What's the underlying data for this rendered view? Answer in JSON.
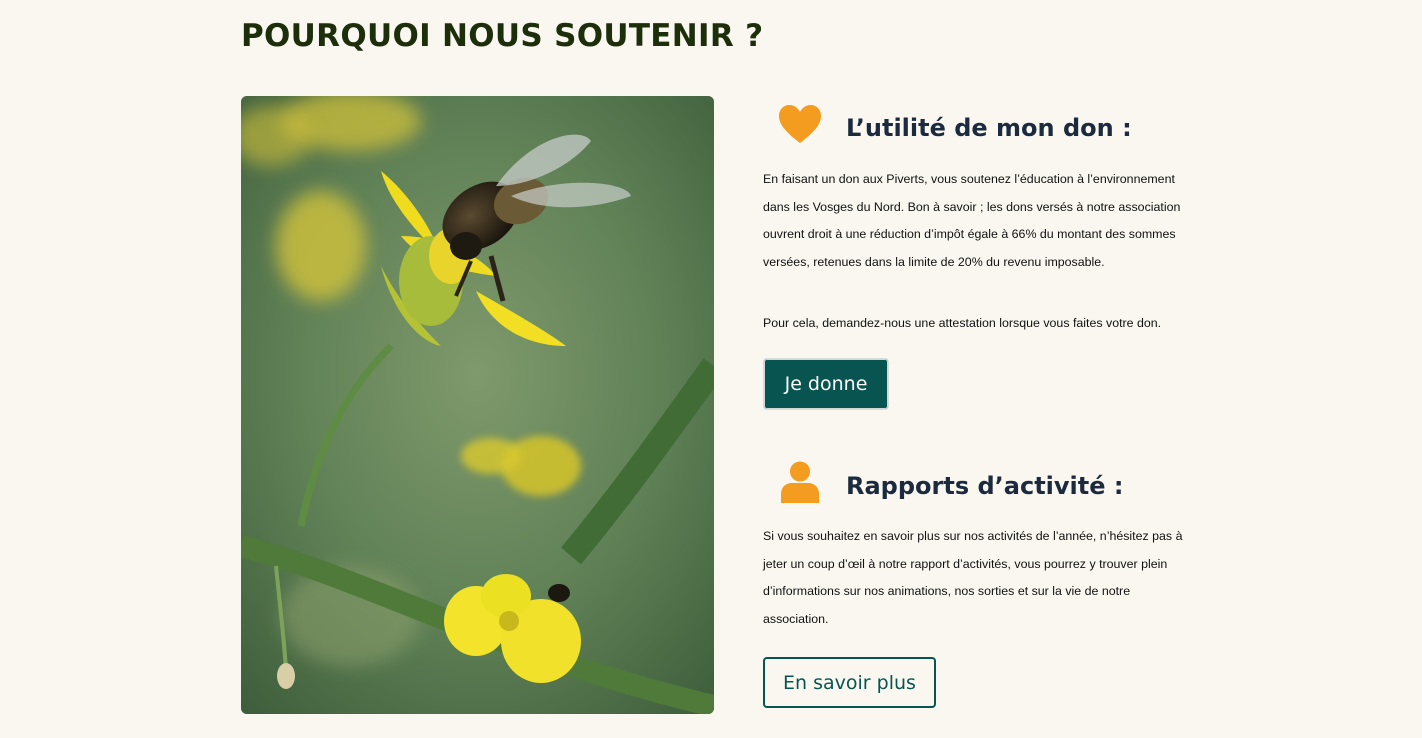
{
  "page": {
    "title": "POURQUOI NOUS SOUTENIR ?"
  },
  "photo": {
    "subject": "bee-on-yellow-flower"
  },
  "donation": {
    "icon": "heart-icon",
    "heading": "L’utilité de mon don :",
    "paragraph_1": "En faisant un don aux Piverts, vous soutenez l’éducation à l’environnement dans les Vosges du Nord. Bon à savoir ; les dons versés à notre association ouvrent droit à une réduction d’impôt égale à 66% du montant des sommes versées, retenues dans la limite de 20% du revenu imposable.",
    "paragraph_2": "Pour cela, demandez-nous une attestation lorsque vous faites votre don.",
    "button_label": "Je donne"
  },
  "reports": {
    "icon": "user-icon",
    "heading": "Rapports d’activité :",
    "paragraph": "Si vous souhaitez en savoir plus sur nos activités de l’année, n’hésitez pas à jeter un coup d’œil à notre rapport d’activités, vous pourrez y trouver plein d’informations sur nos animations, nos sorties et sur la vie de notre association.",
    "button_label": "En savoir plus"
  },
  "colors": {
    "background": "#faf7f0",
    "title": "#1c2e0a",
    "heading": "#1b2a3e",
    "accent_orange": "#f39c1f",
    "button_teal": "#075451"
  }
}
